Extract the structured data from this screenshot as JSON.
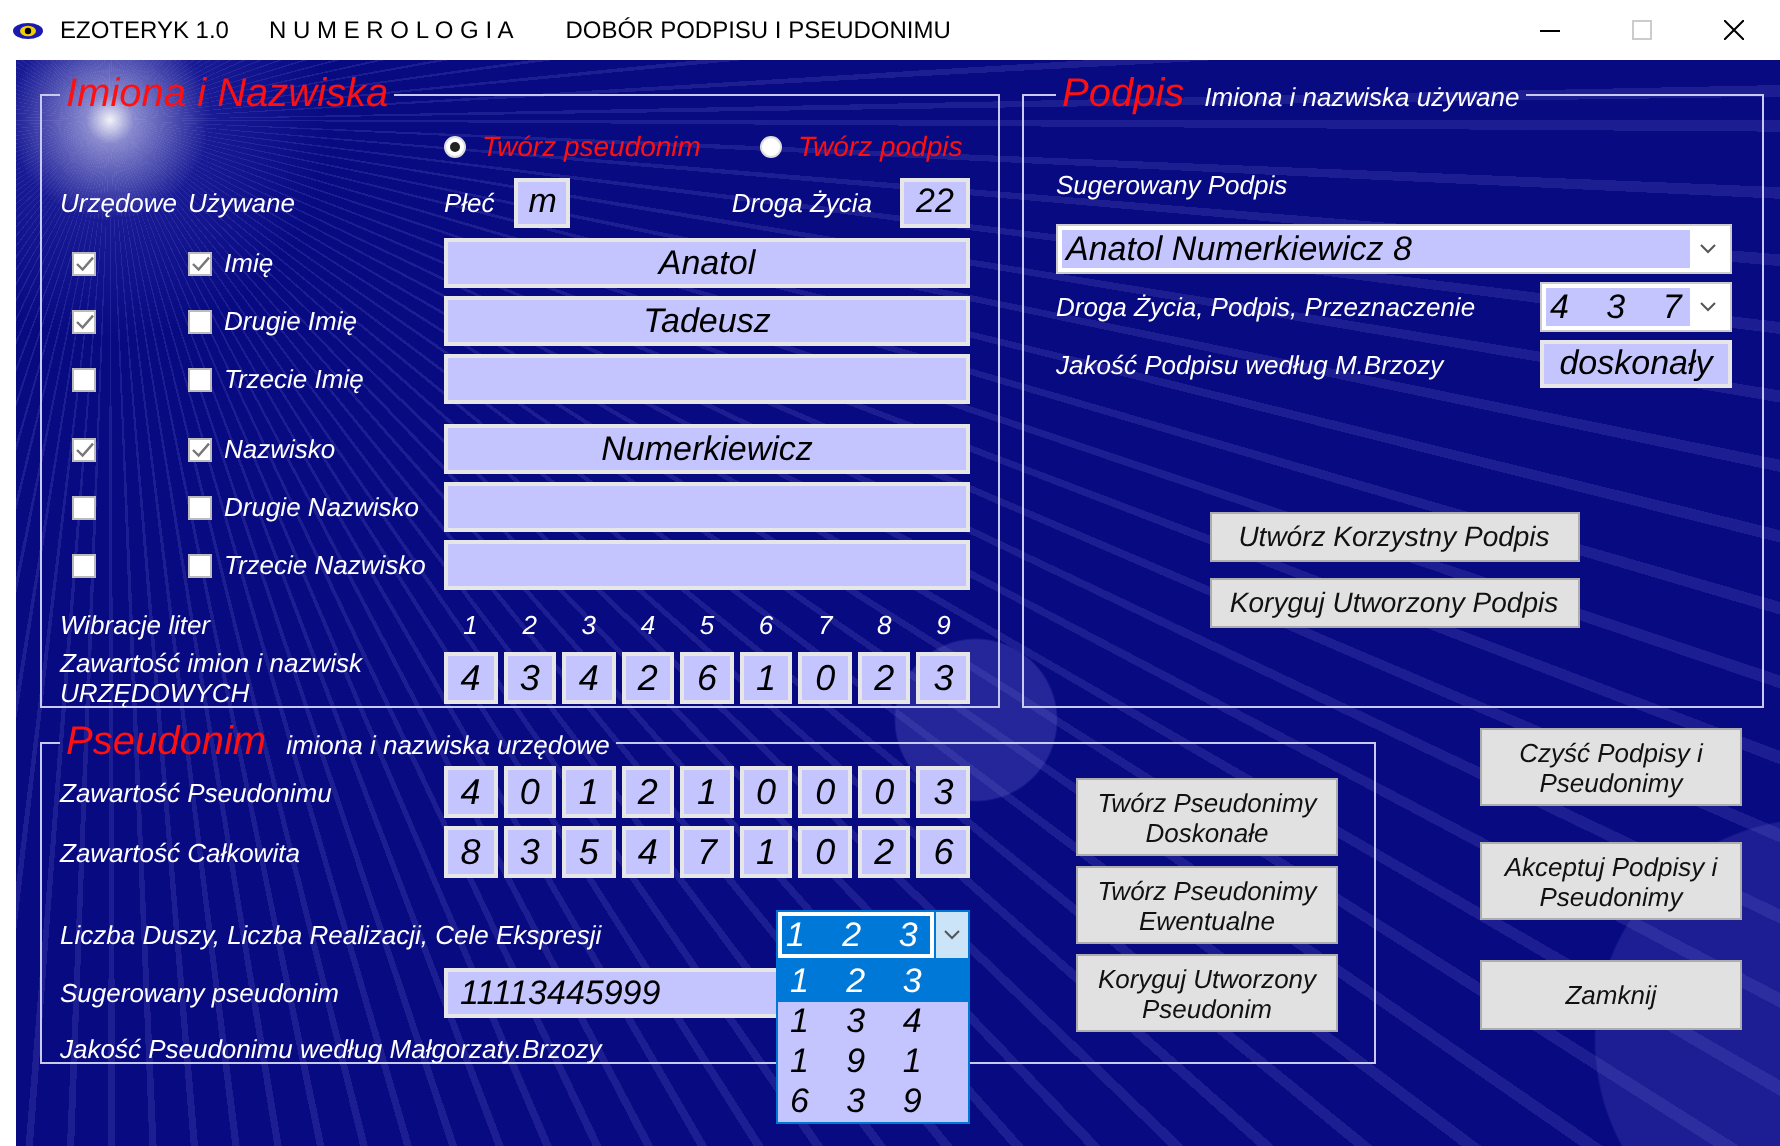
{
  "window": {
    "title_parts": [
      "EZOTERYK 1.0",
      "N U M E R O L O G I A",
      "DOBÓR PODPISU I PSEUDONIMU"
    ]
  },
  "names_panel": {
    "title": "Imiona i Nazwiska",
    "modes": [
      {
        "label": "Twórz pseudonim",
        "selected": true
      },
      {
        "label": "Twórz podpis",
        "selected": false
      }
    ],
    "column_headers": [
      "Urzędowe",
      "Używane"
    ],
    "gender": {
      "label": "Płeć",
      "value": "m"
    },
    "life_path": {
      "label": "Droga Życia",
      "value": "22"
    },
    "first_names": [
      {
        "label": "Imię",
        "official": true,
        "used": true,
        "value": "Anatol"
      },
      {
        "label": "Drugie Imię",
        "official": true,
        "used": false,
        "value": "Tadeusz"
      },
      {
        "label": "Trzecie Imię",
        "official": false,
        "used": false
      }
    ],
    "surnames": [
      {
        "label": "Nazwisko",
        "official": true,
        "used": true,
        "value": "Numerkiewicz"
      },
      {
        "label": "Drugie Nazwisko",
        "official": false,
        "used": false
      },
      {
        "label": "Trzecie Nazwisko",
        "official": false,
        "used": false
      }
    ],
    "vibrations": {
      "label": "Wibracje liter",
      "numbers": [
        "1",
        "2",
        "3",
        "4",
        "5",
        "6",
        "7",
        "8",
        "9"
      ]
    },
    "official_content": {
      "label": "Zawartość imion i nazwisk\nURZĘDOWYCH",
      "values": [
        "4",
        "3",
        "4",
        "2",
        "6",
        "1",
        "0",
        "2",
        "3"
      ]
    }
  },
  "signature_panel": {
    "title": "Podpis",
    "subtitle": "Imiona i nazwiska używane",
    "suggested_label": "Sugerowany Podpis",
    "suggested_value": "Anatol Numerkiewicz 8",
    "numbers_label": "Droga Życia, Podpis, Przeznaczenie",
    "numbers_value": "4 3 7",
    "quality_label": "Jakość Podpisu według M.Brzozy",
    "quality_value": "doskonały",
    "buttons": [
      "Utwórz Korzystny Podpis",
      "Koryguj Utworzony Podpis"
    ]
  },
  "pseudonym_panel": {
    "title": "Pseudonim",
    "subtitle": "imiona i nazwiska urzędowe",
    "content_rows": [
      {
        "label": "Zawartość Pseudonimu",
        "values": [
          "4",
          "0",
          "1",
          "2",
          "1",
          "0",
          "0",
          "0",
          "3"
        ]
      },
      {
        "label": "Zawartość Całkowita",
        "values": [
          "8",
          "3",
          "5",
          "4",
          "7",
          "1",
          "0",
          "2",
          "6"
        ]
      }
    ],
    "numbers_label": "Liczba Duszy, Liczba Realizacji, Cele Ekspresji",
    "numbers_value": "1 2 3",
    "numbers_options": [
      {
        "label": "1 2 3",
        "selected": true
      },
      {
        "label": "1 3 4",
        "selected": false
      },
      {
        "label": "1 9 1",
        "selected": false
      },
      {
        "label": "6 3 9",
        "selected": false
      }
    ],
    "suggested_label": "Sugerowany pseudonim",
    "suggested_value": "11113445999",
    "quality_label": "Jakość Pseudonimu według Małgorzaty.Brzozy",
    "buttons": [
      "Twórz Pseudonimy Doskonałe",
      "Twórz Pseudonimy Ewentualne",
      "Koryguj Utworzony Pseudonim"
    ]
  },
  "actions": [
    "Czyść Podpisy i Pseudonimy",
    "Akceptuj Podpisy i Pseudonimy",
    "Zamknij"
  ]
}
